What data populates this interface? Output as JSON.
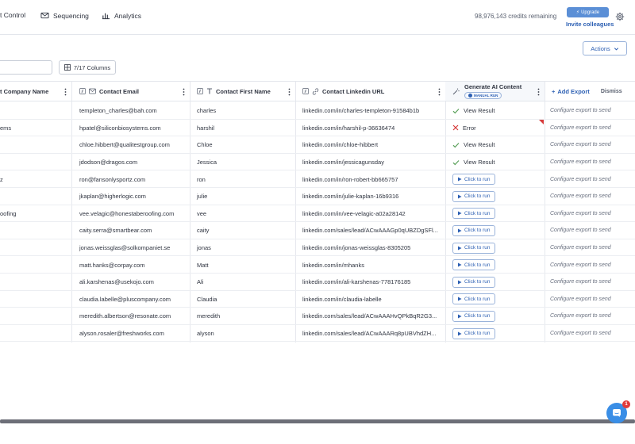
{
  "nav": {
    "control": "t Control",
    "sequencing": "Sequencing",
    "analytics": "Analytics"
  },
  "account": {
    "credits": "98,976,143 credits remaining",
    "upgrade": "Upgrade",
    "invite": "Invite colleagues"
  },
  "toolbar": {
    "actions": "Actions",
    "columns": "7/17 Columns"
  },
  "columns": {
    "company": "t Company Name",
    "email": "Contact Email",
    "first_name": "Contact First Name",
    "linkedin": "Contact Linkedin URL",
    "ai": "Generate AI Content",
    "manual_run": "MANUAL RUN",
    "add_export": "Add Export",
    "dismiss": "Dismiss"
  },
  "labels": {
    "view_result": "View Result",
    "error": "Error",
    "click_to_run": "Click to run",
    "configure_export": "Configure export to send"
  },
  "colors": {
    "accent": "#2c5fb3",
    "success": "#5aa05a",
    "error": "#d63a3a",
    "chat": "#3a8ee6"
  },
  "rows": [
    {
      "company": "",
      "email": "templeton_charles@bah.com",
      "first_name": "charles",
      "linkedin": "linkedin.com/in/charles-templeton-91584b1b",
      "status": "view"
    },
    {
      "company": "ems",
      "email": "hpatel@siliconbiosystems.com",
      "first_name": "harshil",
      "linkedin": "linkedin.com/in/harshil-p-36636474",
      "status": "error"
    },
    {
      "company": "",
      "email": "chloe.hibbert@qualitestgroup.com",
      "first_name": "Chloe",
      "linkedin": "linkedin.com/in/chloe-hibbert",
      "status": "view"
    },
    {
      "company": "",
      "email": "jdodson@dragos.com",
      "first_name": "Jessica",
      "linkedin": "linkedin.com/in/jessicagunsday",
      "status": "view"
    },
    {
      "company": "z",
      "email": "ron@fansonlysportz.com",
      "first_name": "ron",
      "linkedin": "linkedin.com/in/ron-robert-bb665757",
      "status": "run"
    },
    {
      "company": "",
      "email": "jkaplan@higherlogic.com",
      "first_name": "julie",
      "linkedin": "linkedin.com/in/julie-kaplan-16b9316",
      "status": "run"
    },
    {
      "company": "oofing",
      "email": "vee.velagic@honestaberoofing.com",
      "first_name": "vee",
      "linkedin": "linkedin.com/in/vee-velagic-a02a28142",
      "status": "run"
    },
    {
      "company": "",
      "email": "caity.serra@smartbear.com",
      "first_name": "caity",
      "linkedin": "linkedin.com/sales/lead/ACwAAAGp0qUBZDgSFl...",
      "status": "run"
    },
    {
      "company": "",
      "email": "jonas.weissglas@solkompaniet.se",
      "first_name": "jonas",
      "linkedin": "linkedin.com/in/jonas-weissglas-8305205",
      "status": "run"
    },
    {
      "company": "",
      "email": "matt.hanks@corpay.com",
      "first_name": "Matt",
      "linkedin": "linkedin.com/in/mhanks",
      "status": "run"
    },
    {
      "company": "",
      "email": "ali.karshenas@usekojo.com",
      "first_name": "Ali",
      "linkedin": "linkedin.com/in/ali-karshenas-778176185",
      "status": "run"
    },
    {
      "company": "",
      "email": "claudia.labelle@pluscompany.com",
      "first_name": "Claudia",
      "linkedin": "linkedin.com/in/claudia-labelle",
      "status": "run"
    },
    {
      "company": "",
      "email": "meredith.albertson@resonate.com",
      "first_name": "meredith",
      "linkedin": "linkedin.com/sales/lead/ACwAAAHvQPkBqR2G3...",
      "status": "run"
    },
    {
      "company": "",
      "email": "alyson.rosaler@freshworks.com",
      "first_name": "alyson",
      "linkedin": "linkedin.com/sales/lead/ACwAAARq8pUBVhdZH...",
      "status": "run"
    }
  ],
  "chat": {
    "badge_count": "1"
  }
}
